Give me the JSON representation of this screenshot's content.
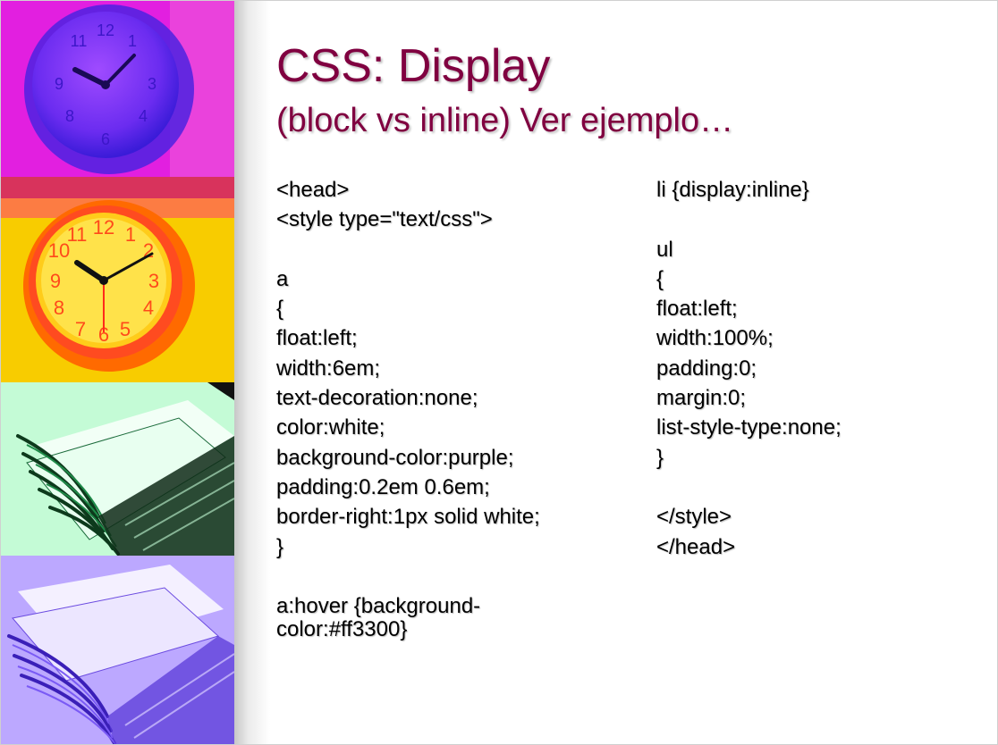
{
  "slide": {
    "title": "CSS: Display",
    "subtitle": "(block vs inline) Ver ejemplo…",
    "left_code_lines": [
      "<head>",
      "<style type=\"text/css\">",
      "",
      "a",
      "{",
      "float:left;",
      "width:6em;",
      "text-decoration:none;",
      "color:white;",
      "background-color:purple;",
      "padding:0.2em 0.6em;",
      "border-right:1px solid white;",
      "}"
    ],
    "left_code_tail": [
      "a:hover {background-",
      "color:#ff3300}"
    ],
    "right_code_lines": [
      "li {display:inline}",
      "",
      "ul",
      "{",
      "float:left;",
      "width:100%;",
      "padding:0;",
      "margin:0;",
      "list-style-type:none;",
      "}",
      "",
      "</style>",
      "</head>"
    ]
  },
  "colors": {
    "title": "#800040",
    "text": "#000000",
    "panel_magenta": "#e21fe0",
    "panel_yellow": "#f5c400",
    "panel_green": "#b8f7cc",
    "panel_violet": "#b9a4ff"
  }
}
